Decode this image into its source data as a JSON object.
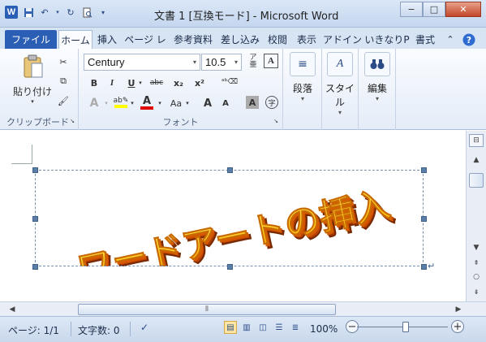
{
  "window": {
    "title": "文書 1 [互換モード] - Microsoft Word",
    "app_icon": "W",
    "buttons": {
      "minimize": "−",
      "maximize": "□",
      "close": "✕"
    }
  },
  "tabs": {
    "file": "ファイル",
    "home": "ホーム",
    "insert": "挿入",
    "page_layout": "ページ レ",
    "references": "参考資料",
    "mailings": "差し込み",
    "review": "校閲",
    "view": "表示",
    "addins": "アドイン",
    "custom": "いきなりP",
    "format": "書式"
  },
  "ribbon": {
    "clipboard": {
      "label": "クリップボード",
      "paste": "貼り付け"
    },
    "font": {
      "label": "フォント",
      "font_name": "Century",
      "font_size": "10.5",
      "bold": "B",
      "italic": "I",
      "underline": "U",
      "strikethrough": "abc",
      "subscript": "x₂",
      "superscript": "x²",
      "case": "Aa",
      "grow": "A",
      "shrink": "A",
      "highlight_color": "#ffff00",
      "font_color": "#e00000"
    },
    "paragraph": {
      "label": "段落"
    },
    "styles": {
      "label": "スタイル"
    },
    "editing": {
      "label": "編集"
    }
  },
  "document": {
    "wordart_text": "ワードアートの挿入",
    "wordart_colors": {
      "face": "#ffb300",
      "side": "#c84600"
    }
  },
  "status_bar": {
    "page": "ページ: 1/1",
    "word_count": "文字数: 0",
    "zoom": "100%",
    "zoom_out": "−",
    "zoom_in": "+"
  },
  "colors": {
    "accent": "#2b5fb6",
    "ribbon_bg": "#e4ecf7"
  }
}
